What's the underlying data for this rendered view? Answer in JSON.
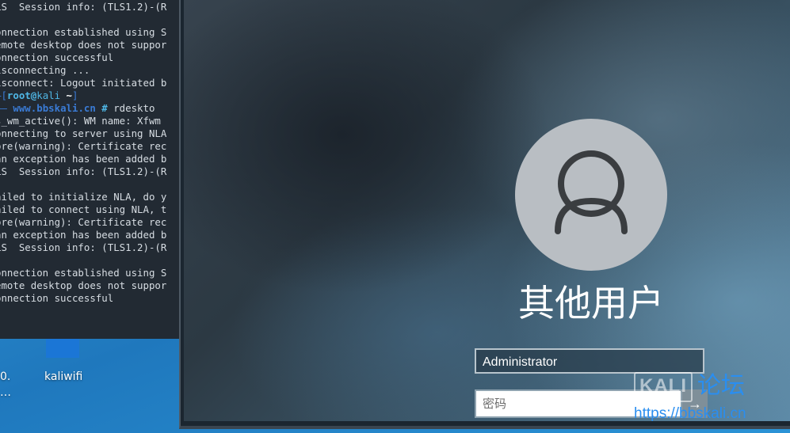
{
  "desktop": {
    "icon_label_left": "0.",
    "icon_label_left2": "…",
    "icon_label_kaliwifi": "kaliwifi"
  },
  "terminal": {
    "lines": [
      "LS  Session info: (TLS1.2)-(R",
      "",
      "onnection established using S",
      "emote desktop does not suppor",
      "onnection successful",
      "isconnecting ...",
      "isconnect: Logout initiated b",
      "",
      "",
      "s_wm_active(): WM name: Xfwm",
      "onnecting to server using NLA",
      "ore(warning): Certificate rec",
      "an exception has been added b",
      "LS  Session info: (TLS1.2)-(R",
      "",
      "ailed to initialize NLA, do y",
      "ailed to connect using NLA, t",
      "ore(warning): Certificate rec",
      "an exception has been added b",
      "LS  Session info: (TLS1.2)-(R",
      "",
      "onnection established using S",
      "emote desktop does not suppor",
      "onnection successful"
    ],
    "prompt": {
      "bracket_open": "–[",
      "user": "root",
      "at": "@",
      "host": "kali",
      "dir": " ~",
      "bracket_close": "]",
      "site_prefix": "—— ",
      "site": "www.bbskali.cn",
      "hash": " # ",
      "command": "rdeskto"
    }
  },
  "login": {
    "title": "其他用户",
    "username_value": "Administrator",
    "password_placeholder": "密码",
    "submit_glyph": "→"
  },
  "watermark": {
    "kali": "KALI",
    "forum": "论坛",
    "url": "https://bbskali.cn"
  }
}
